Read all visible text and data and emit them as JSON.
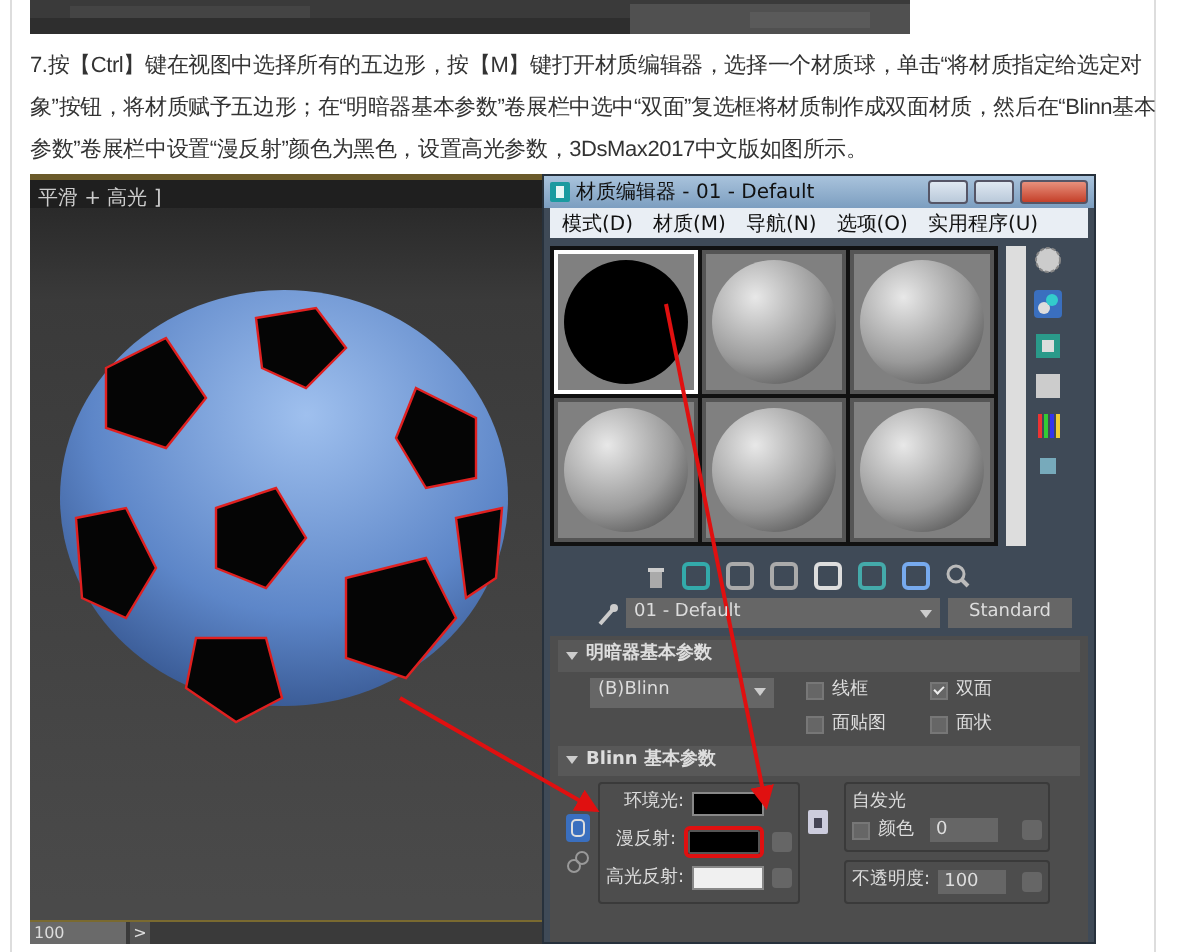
{
  "article": {
    "paragraph": "7.按【Ctrl】键在视图中选择所有的五边形，按【M】键打开材质编辑器，选择一个材质球，单击“将材质指定给选定对象”按钮，将材质赋予五边形；在“明暗器基本参数”卷展栏中选中“双面”复选框将材质制作成双面材质，然后在“Blinn基本参数”卷展栏中设置“漫反射”颜色为黑色，设置高光参数，3DsMax2017中文版如图所示。"
  },
  "viewport": {
    "label": "平滑 + 高光 ]",
    "frame_field": "100",
    "next_button": ">"
  },
  "material_editor": {
    "title": "材质编辑器 - 01 - Default",
    "menu": [
      "模式(D)",
      "材质(M)",
      "导航(N)",
      "选项(O)",
      "实用程序(U)"
    ],
    "slots": [
      {
        "kind": "black",
        "selected": true
      },
      {
        "kind": "grey",
        "selected": false
      },
      {
        "kind": "grey",
        "selected": false
      },
      {
        "kind": "grey",
        "selected": false
      },
      {
        "kind": "grey",
        "selected": false
      },
      {
        "kind": "grey",
        "selected": false
      }
    ],
    "material_name": "01 - Default",
    "material_type": "Standard",
    "shader_rollout": {
      "title": "明暗器基本参数",
      "shader": "(B)Blinn",
      "options": [
        {
          "label": "线框",
          "checked": false
        },
        {
          "label": "双面",
          "checked": true
        },
        {
          "label": "面贴图",
          "checked": false
        },
        {
          "label": "面状",
          "checked": false
        }
      ]
    },
    "blinn_rollout": {
      "title": "Blinn 基本参数",
      "colors": [
        {
          "label": "环境光:",
          "color": "#000000",
          "highlighted": false
        },
        {
          "label": "漫反射:",
          "color": "#000000",
          "highlighted": true
        },
        {
          "label": "高光反射:",
          "color": "#f0f0f0",
          "highlighted": false
        }
      ],
      "self_illum": {
        "title": "自发光",
        "checkbox_label": "颜色",
        "checked": false,
        "value": "0"
      },
      "opacity": {
        "label": "不透明度:",
        "value": "100"
      }
    }
  }
}
